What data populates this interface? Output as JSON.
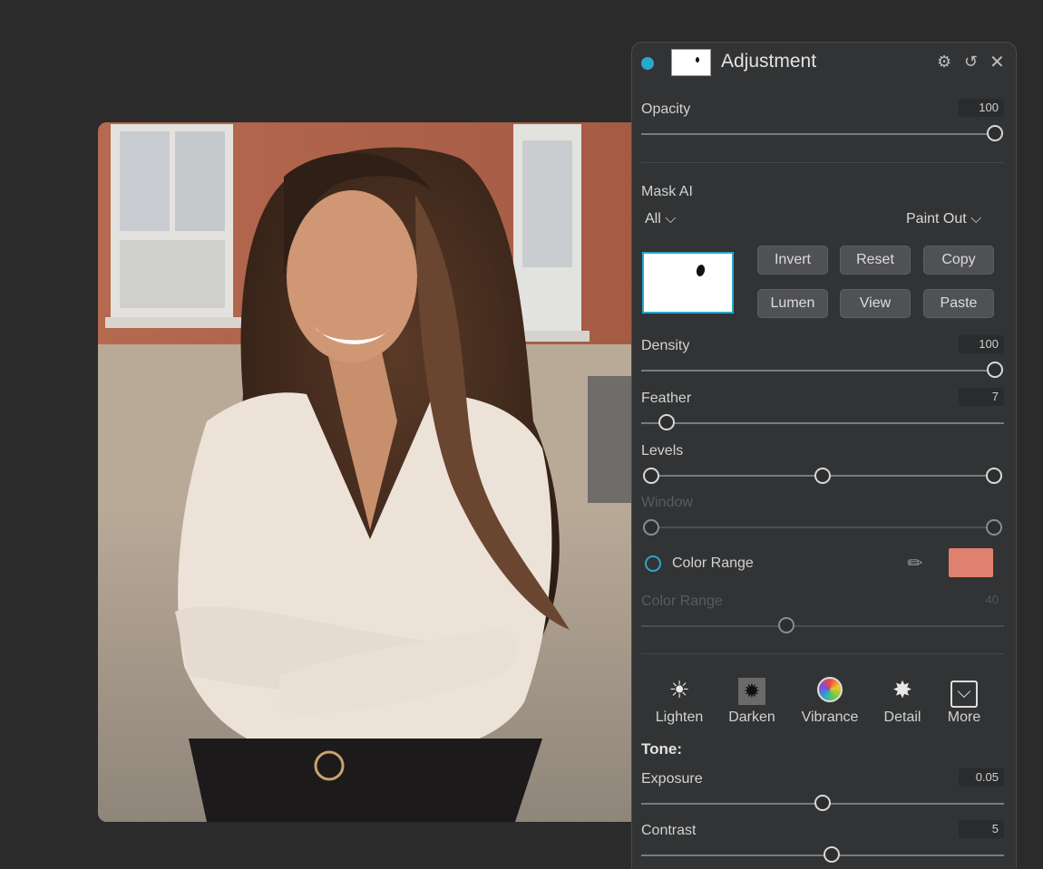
{
  "panel": {
    "title": "Adjustment",
    "header_icons": [
      "gear-icon",
      "undo-icon",
      "close-icon"
    ]
  },
  "sliders": {
    "opacity": {
      "label": "Opacity",
      "value": "100",
      "level": 1.0
    },
    "density": {
      "label": "Density",
      "value": "100",
      "level": 1.0
    },
    "feather": {
      "label": "Feather",
      "value": "7",
      "level": 0.07
    },
    "levels": {
      "label": "Levels",
      "points": [
        0,
        0.5,
        1
      ]
    },
    "window": {
      "label": "Window",
      "points": [
        0,
        1
      ]
    },
    "color_range": {
      "label": "Color Range",
      "value": "40",
      "level": 0.4
    },
    "exposure": {
      "label": "Exposure",
      "value": "0.05",
      "level": 0.5
    },
    "contrast": {
      "label": "Contrast",
      "value": "5",
      "level": 0.525
    }
  },
  "mask": {
    "title": "Mask AI",
    "scope": "All",
    "mode": "Paint Out",
    "buttons": [
      "Invert",
      "Reset",
      "Copy",
      "Lumen",
      "View",
      "Paste"
    ]
  },
  "color_range_toggle": {
    "label": "Color Range",
    "swatch_color": "#e0806e"
  },
  "tools": [
    {
      "label": "Lighten",
      "icon": "sun-icon"
    },
    {
      "label": "Darken",
      "icon": "dark-sun-icon"
    },
    {
      "label": "Vibrance",
      "icon": "color-wheel-icon"
    },
    {
      "label": "Detail",
      "icon": "sparkle-icon"
    },
    {
      "label": "More",
      "icon": "more-icon"
    }
  ],
  "tone_label": "Tone:",
  "colors": {
    "accent": "#2aa7c9",
    "panel_bg": "#323334",
    "page_bg": "#2b2b2c"
  }
}
